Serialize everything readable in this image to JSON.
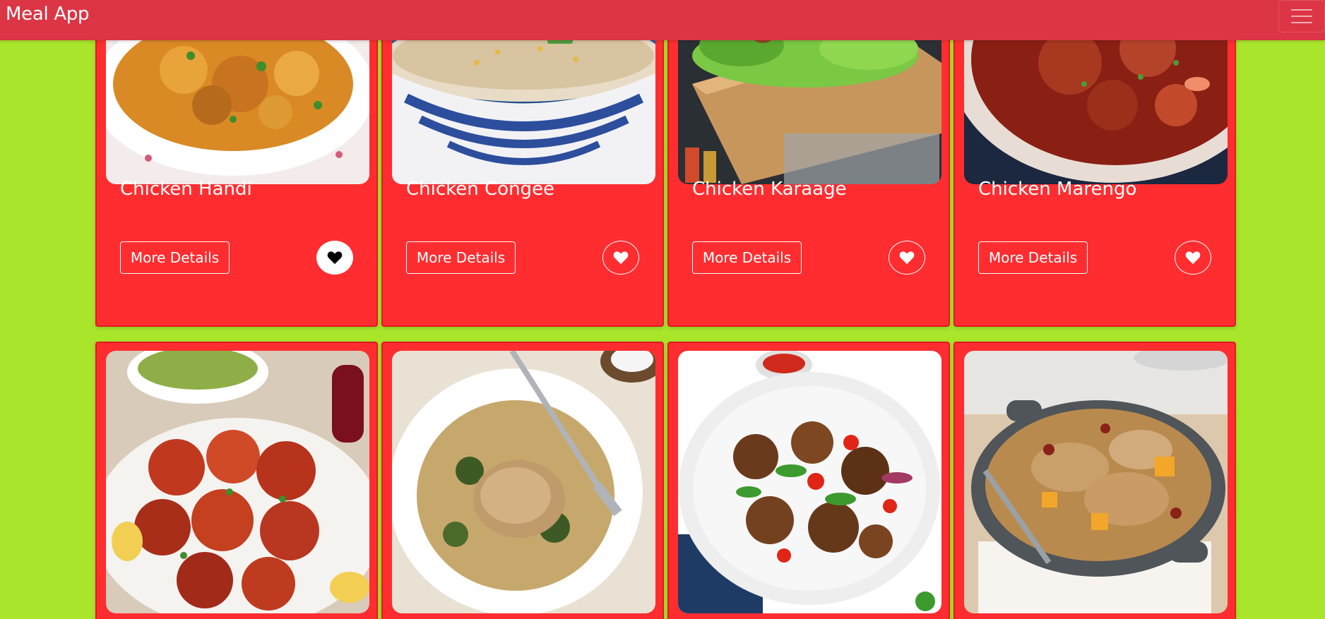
{
  "navbar": {
    "brand": "Meal App",
    "menu_icon": "hamburger-menu-icon"
  },
  "cards": [
    {
      "title": "Chicken Handi",
      "button": "More Details",
      "favorited": true,
      "image": "chicken-handi-photo"
    },
    {
      "title": "Chicken Congee",
      "button": "More Details",
      "favorited": false,
      "image": "chicken-congee-photo"
    },
    {
      "title": "Chicken Karaage",
      "button": "More Details",
      "favorited": false,
      "image": "chicken-karaage-photo"
    },
    {
      "title": "Chicken Marengo",
      "button": "More Details",
      "favorited": false,
      "image": "chicken-marengo-photo"
    },
    {
      "title": "",
      "button": "",
      "favorited": false,
      "image": "tandoori-chicken-photo"
    },
    {
      "title": "",
      "button": "",
      "favorited": false,
      "image": "chicken-couscous-photo"
    },
    {
      "title": "",
      "button": "",
      "favorited": false,
      "image": "kung-pao-chicken-photo"
    },
    {
      "title": "",
      "button": "",
      "favorited": false,
      "image": "chicken-paella-photo"
    }
  ],
  "colors": {
    "page_background": "#a9e52b",
    "navbar": "#dc3545",
    "card": "#ff2d30"
  }
}
